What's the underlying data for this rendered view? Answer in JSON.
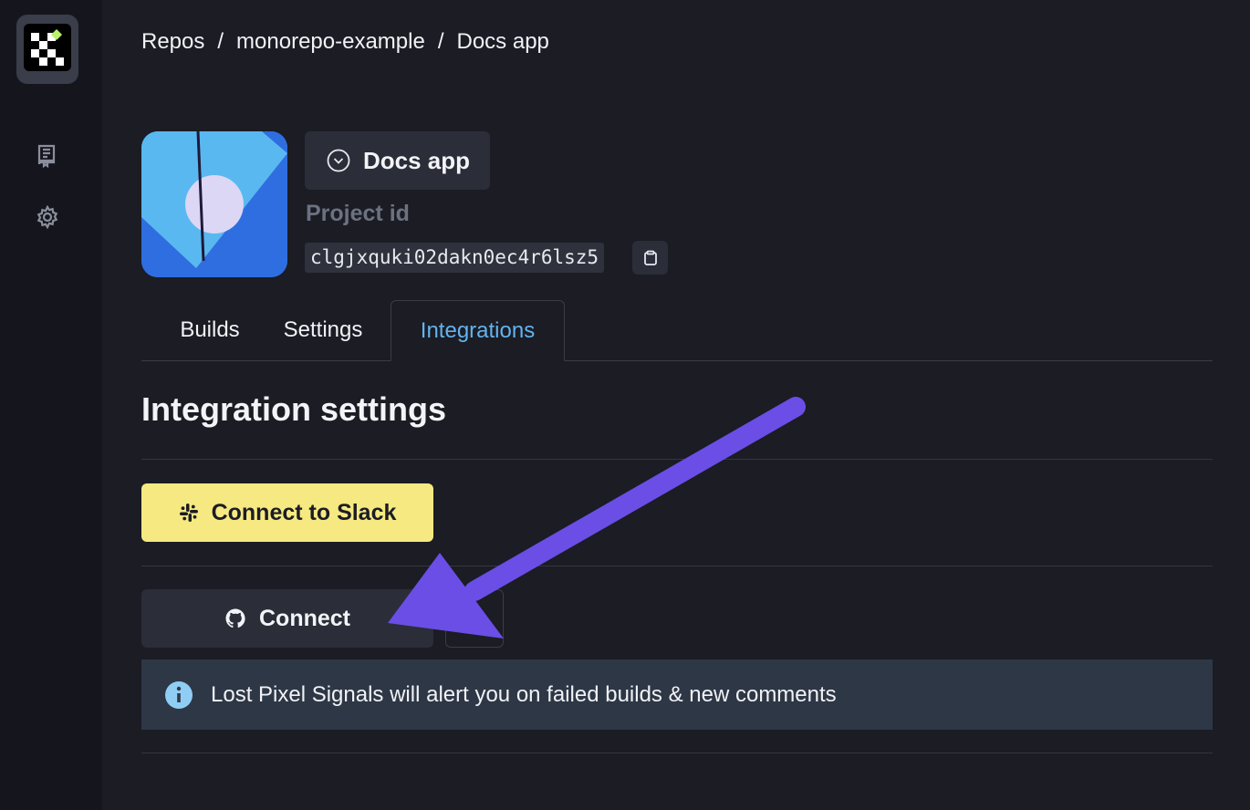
{
  "breadcrumb": {
    "items": [
      "Repos",
      "monorepo-example",
      "Docs app"
    ],
    "separator": "/"
  },
  "sidebar": {
    "logo_icon": "lost-pixel-logo-icon",
    "items": [
      {
        "icon": "repo-book-icon"
      },
      {
        "icon": "gear-icon"
      }
    ]
  },
  "project": {
    "selector_label": "Docs app",
    "id_label": "Project id",
    "id_value": "clgjxquki02dakn0ec4r6lsz5",
    "copy_icon": "copy-icon"
  },
  "tabs": [
    {
      "label": "Builds",
      "active": false
    },
    {
      "label": "Settings",
      "active": false
    },
    {
      "label": "Integrations",
      "active": true
    }
  ],
  "main": {
    "section_title": "Integration settings",
    "slack_button": "Connect to Slack",
    "github_button": "Connect",
    "alert_text": "Lost Pixel Signals will alert you on failed builds & new comments"
  },
  "colors": {
    "background": "#1b1c24",
    "sidebar": "#15161d",
    "accent_tab": "#63b3ed",
    "slack_button": "#f6e982",
    "alert_bg": "#2e3746",
    "annotation_arrow": "#6a4ee6"
  }
}
